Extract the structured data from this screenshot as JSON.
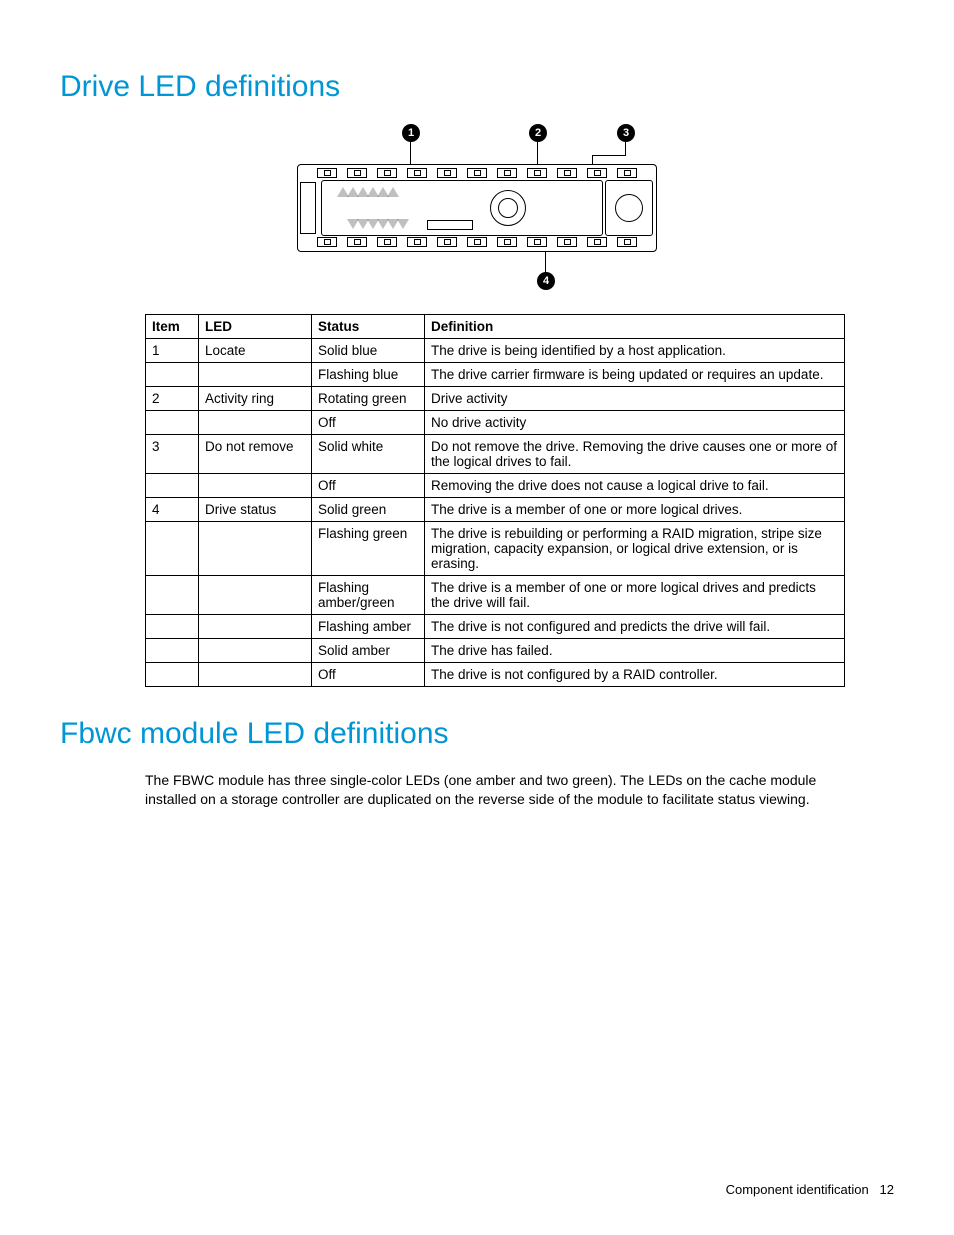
{
  "section1": {
    "title": "Drive LED definitions",
    "callouts": [
      "1",
      "2",
      "3",
      "4"
    ],
    "table": {
      "headers": [
        "Item",
        "LED",
        "Status",
        "Definition"
      ],
      "rows": [
        [
          "1",
          "Locate",
          "Solid blue",
          "The drive is being identified by a host application."
        ],
        [
          "",
          "",
          "Flashing blue",
          "The drive carrier firmware is being updated or requires an update."
        ],
        [
          "2",
          "Activity ring",
          "Rotating green",
          "Drive activity"
        ],
        [
          "",
          "",
          "Off",
          "No drive activity"
        ],
        [
          "3",
          "Do not remove",
          "Solid white",
          "Do not remove the drive. Removing the drive causes one or more of the logical drives to fail."
        ],
        [
          "",
          "",
          "Off",
          "Removing the drive does not cause a logical drive to fail."
        ],
        [
          "4",
          "Drive status",
          "Solid green",
          "The drive is a member of one or more logical drives."
        ],
        [
          "",
          "",
          "Flashing green",
          "The drive is rebuilding or performing a RAID migration, stripe size migration, capacity expansion, or logical drive extension, or is erasing."
        ],
        [
          "",
          "",
          "Flashing amber/green",
          "The drive is a member of one or more logical drives and predicts the drive will fail."
        ],
        [
          "",
          "",
          "Flashing amber",
          "The drive is not configured and predicts the drive will fail."
        ],
        [
          "",
          "",
          "Solid amber",
          "The drive has failed."
        ],
        [
          "",
          "",
          "Off",
          "The drive is not configured by a RAID controller."
        ]
      ]
    }
  },
  "section2": {
    "title": "Fbwc module LED definitions",
    "paragraph": "The FBWC module has three single-color LEDs (one amber and two green). The LEDs on the cache module installed on a storage controller are duplicated on the reverse side of the module to facilitate status viewing."
  },
  "footer": {
    "section": "Component identification",
    "page": "12"
  }
}
